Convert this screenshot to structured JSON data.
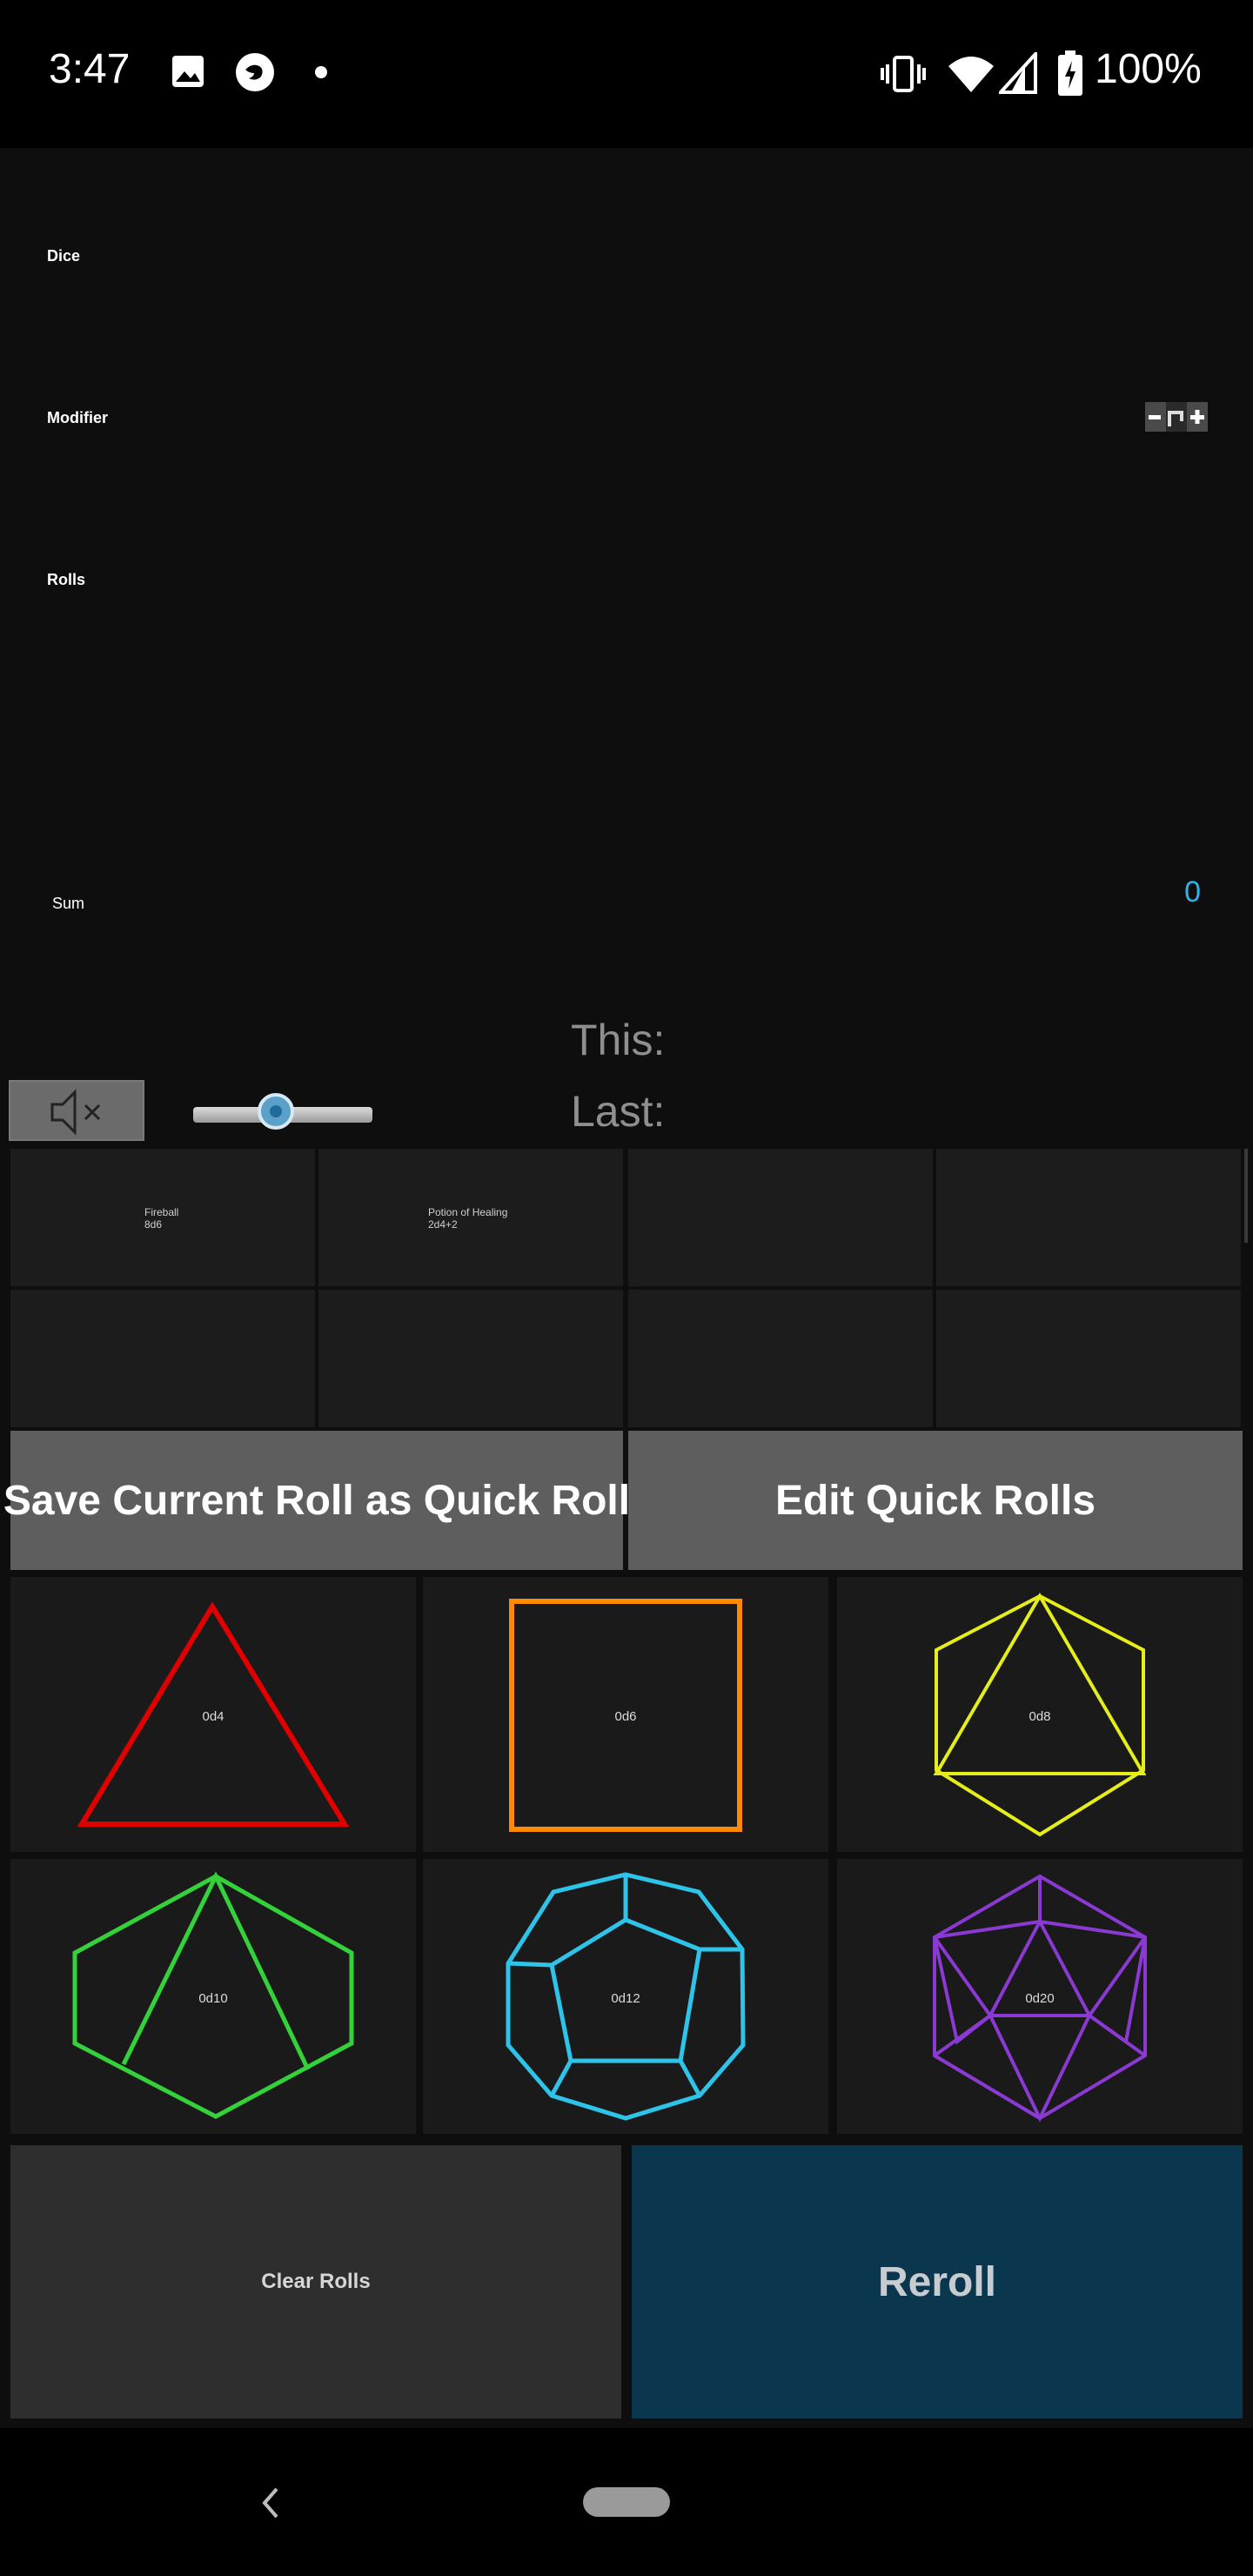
{
  "status_bar": {
    "time": "3:47",
    "battery_text": "100%",
    "icons": [
      "gallery-icon",
      "firefox-icon",
      "notification-dot-icon",
      "vibrate-icon",
      "wifi-icon",
      "cell-signal-icon",
      "battery-charging-icon"
    ]
  },
  "sections": {
    "dice_label": "Dice",
    "modifier_label": "Modifier",
    "rolls_label": "Rolls",
    "sum_label": "Sum",
    "sum_value": "0"
  },
  "history": {
    "this_label": "This:",
    "last_label": "Last:"
  },
  "volume": {
    "level": 0.46,
    "muted": true
  },
  "quick_rolls": [
    {
      "name": "Fireball",
      "formula": "8d6"
    },
    {
      "name": "Potion of Healing",
      "formula": "2d4+2"
    },
    {
      "name": "",
      "formula": ""
    },
    {
      "name": "",
      "formula": ""
    },
    {
      "name": "",
      "formula": ""
    },
    {
      "name": "",
      "formula": ""
    },
    {
      "name": "",
      "formula": ""
    },
    {
      "name": "",
      "formula": ""
    }
  ],
  "buttons": {
    "save_quick_roll": "Save Current Roll as Quick Roll",
    "edit_quick_rolls": "Edit Quick Rolls",
    "clear_rolls": "Clear Rolls",
    "reroll": "Reroll"
  },
  "dice": [
    {
      "label": "0d4",
      "color": "#e00000"
    },
    {
      "label": "0d6",
      "color": "#ff8a00"
    },
    {
      "label": "0d8",
      "color": "#e6ee1a"
    },
    {
      "label": "0d10",
      "color": "#34d23a"
    },
    {
      "label": "0d12",
      "color": "#2ec4ea"
    },
    {
      "label": "0d20",
      "color": "#8a3ad2"
    }
  ],
  "colors": {
    "accent_blue": "#2bb5e8",
    "reroll_bg": "#0b374e"
  }
}
